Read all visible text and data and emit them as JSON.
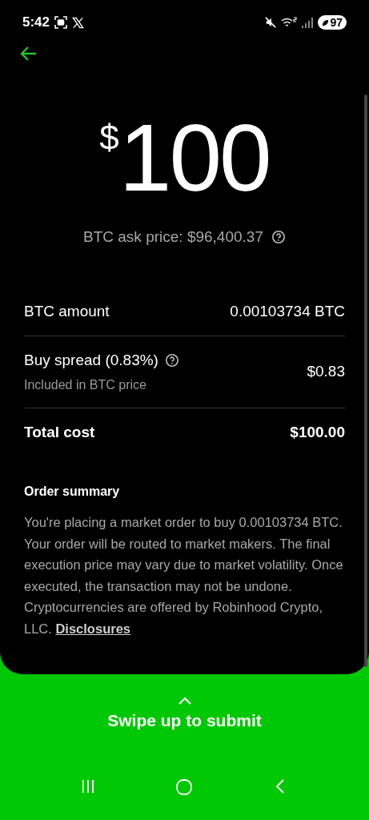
{
  "status_bar": {
    "time": "5:42",
    "battery": "97"
  },
  "amount": {
    "currency": "$",
    "value": "100"
  },
  "ask_price": "BTC ask price: $96,400.37",
  "rows": [
    {
      "kind": "plain",
      "label": "BTC amount",
      "value": "0.00103734 BTC"
    },
    {
      "kind": "info",
      "label": "Buy spread (0.83%)",
      "sublabel": "Included in BTC price",
      "value": "$0.83"
    },
    {
      "kind": "total",
      "label": "Total cost",
      "value": "$100.00"
    }
  ],
  "order_summary": {
    "title": "Order summary",
    "text": "You're placing a market order to buy 0.00103734 BTC. Your order will be routed to market makers. The final execution price may vary due to market volatility. Once executed, the transaction may not be undone. Cryptocurrencies are offered by Robinhood Crypto, LLC.",
    "link": "Disclosures"
  },
  "submit": {
    "label": "Swipe up to submit"
  }
}
